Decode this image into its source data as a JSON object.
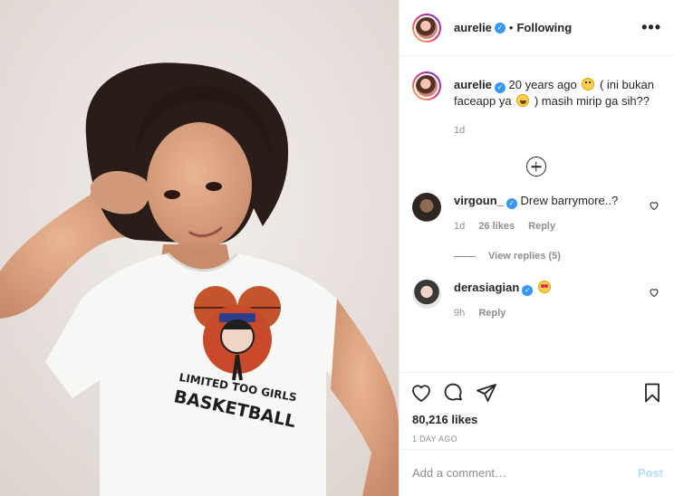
{
  "post": {
    "photo": {
      "shirt_line1": "LIMITED TOO GIRLS",
      "shirt_line2": "BASKETBALL"
    },
    "header": {
      "username": "aurelie",
      "separator": "•",
      "follow_state": "Following",
      "more_icon": "ellipsis-icon"
    },
    "caption": {
      "username": "aurelie",
      "text_part1": "20 years ago",
      "text_part2": "( ini bukan faceapp ya",
      "text_part3": ") masih mirip ga sih??",
      "time": "1d"
    },
    "comments": [
      {
        "username": "virgoun_",
        "text": "Drew barrymore..?",
        "time": "1d",
        "likes": "26 likes",
        "reply": "Reply"
      },
      {
        "username": "derasiagian",
        "text": "",
        "time": "9h",
        "reply": "Reply"
      }
    ],
    "view_replies": "View replies (5)",
    "likes": "80,216 likes",
    "posted_ago": "1 DAY AGO",
    "comment_input": {
      "placeholder": "Add a comment…"
    },
    "post_button": "Post",
    "colors": {
      "verified": "#3897f0",
      "post_disabled": "#b2dffc",
      "meta": "#8e8e8e"
    }
  }
}
